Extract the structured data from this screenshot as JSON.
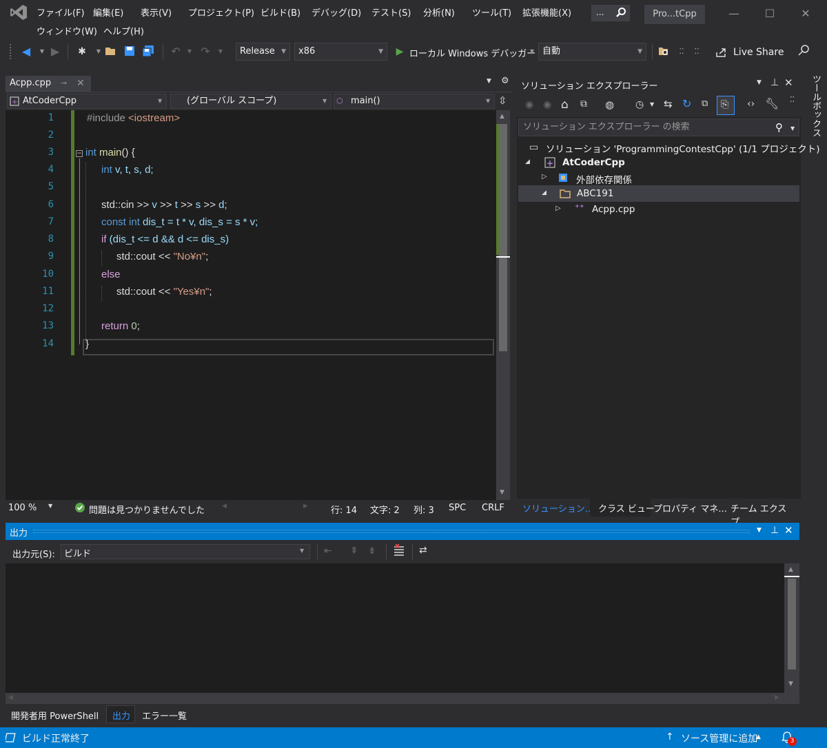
{
  "menu": {
    "items": [
      "ファイル(F)",
      "編集(E)",
      "表示(V)",
      "プロジェクト(P)",
      "ビルド(B)",
      "デバッグ(D)",
      "テスト(S)",
      "分析(N)",
      "ツール(T)",
      "拡張機能(X)",
      "ウィンドウ(W)",
      "ヘルプ(H)"
    ],
    "search_label": "...",
    "project_title": "Pro...tCpp"
  },
  "toolbar": {
    "configuration": "Release",
    "platform": "x86",
    "run_label": "ローカル Windows デバッガー",
    "run_mode": "自動",
    "live_share": "Live Share"
  },
  "editor": {
    "tab_label": "Acpp.cpp",
    "nav_project": "AtCoderCpp",
    "nav_scope": "(グローバル スコープ)",
    "nav_member": "main()",
    "line_numbers": [
      "1",
      "2",
      "3",
      "4",
      "5",
      "6",
      "7",
      "8",
      "9",
      "10",
      "11",
      "12",
      "13",
      "14"
    ],
    "code": {
      "l1a": "#include ",
      "l1b": "<iostream>",
      "l3a": "int",
      "l3b": " ",
      "l3c": "main",
      "l3d": "() {",
      "l4a": "int",
      "l4b": " v, t, s, d;",
      "l6a": "std::cin >> ",
      "l6b": "v",
      "l6c": " >> ",
      "l6d": "t",
      "l6e": " >> ",
      "l6f": "s",
      "l6g": " >> ",
      "l6h": "d",
      "l6i": ";",
      "l7a": "const",
      "l7b": " ",
      "l7c": "int",
      "l7d": " dis_t = t * v, dis_s = s * v;",
      "l8a": "if",
      "l8b": " (dis_t <= d && d <= dis_s)",
      "l9a": "std::cout << ",
      "l9b": "\"No¥n\"",
      "l9c": ";",
      "l10a": "else",
      "l11a": "std::cout << ",
      "l11b": "\"Yes¥n\"",
      "l11c": ";",
      "l13a": "return",
      "l13b": " ",
      "l13c": "0",
      "l13d": ";",
      "l14a": "}"
    },
    "status": {
      "zoom": "100 %",
      "issues": "問題は見つかりませんでした",
      "line": "行: 14",
      "char": "文字: 2",
      "col": "列: 3",
      "whitespace": "SPC",
      "line_ending": "CRLF"
    }
  },
  "solution_explorer": {
    "title": "ソリューション エクスプローラー",
    "search_placeholder": "ソリューション エクスプローラー の検索",
    "solution_label": "ソリューション 'ProgrammingContestCpp' (1/1 プロジェクト)",
    "project_label": "AtCoderCpp",
    "external_deps": "外部依存関係",
    "folder": "ABC191",
    "file": "Acpp.cpp",
    "tabs": [
      "ソリューション...",
      "クラス ビュー",
      "プロパティ マネ...",
      "チーム エクスプ..."
    ]
  },
  "toolbox_label": "ツールボックス",
  "output": {
    "title": "出力",
    "source_label": "出力元(S):",
    "source_value": "ビルド"
  },
  "bottom_tabs": [
    "開発者用 PowerShell",
    "出力",
    "エラー一覧"
  ],
  "statusbar": {
    "message": "ビルド正常終了",
    "source_control": "ソース管理に追加",
    "notification_count": "3"
  },
  "colors": {
    "accent": "#007acc",
    "background": "#2d2d30",
    "editor_bg": "#1e1e1e",
    "keyword": "#569cd6",
    "string": "#d69d85",
    "line_number": "#2b91af",
    "changed_bar": "#577a2e"
  }
}
